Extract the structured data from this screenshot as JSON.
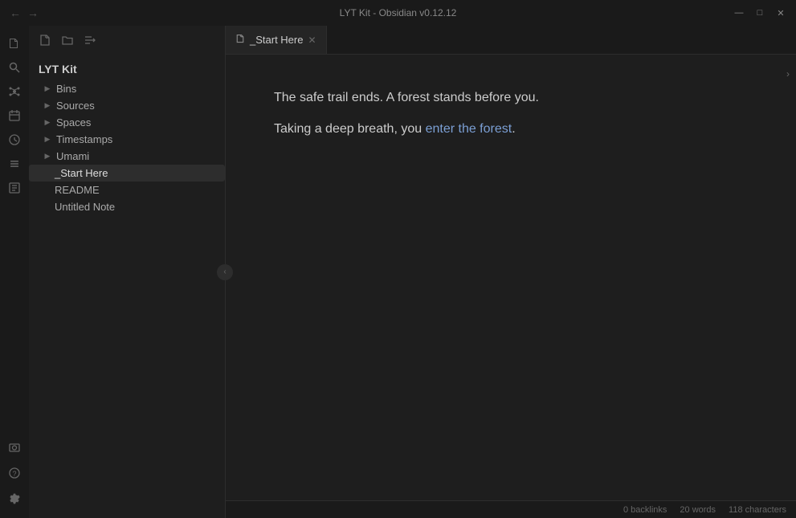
{
  "titleBar": {
    "title": "LYT Kit - Obsidian v0.12.12",
    "btnMinimize": "—",
    "btnMaximize": "□",
    "btnClose": "✕"
  },
  "ribbon": {
    "icons": [
      {
        "name": "files-icon",
        "glyph": "⊞",
        "active": false
      },
      {
        "name": "search-icon",
        "glyph": "⌕",
        "active": false
      },
      {
        "name": "graph-icon",
        "glyph": "⬡",
        "active": false
      },
      {
        "name": "calendar-icon",
        "glyph": "▦",
        "active": false
      },
      {
        "name": "clock-icon",
        "glyph": "◷",
        "active": false
      },
      {
        "name": "layers-icon",
        "glyph": "≡",
        "active": false
      },
      {
        "name": "tag-icon",
        "glyph": "⊡",
        "active": false
      }
    ],
    "bottomIcons": [
      {
        "name": "camera-icon",
        "glyph": "⊙"
      },
      {
        "name": "help-icon",
        "glyph": "?"
      },
      {
        "name": "settings-icon",
        "glyph": "⚙"
      }
    ]
  },
  "sidebar": {
    "toolbar": [
      {
        "name": "new-note-btn",
        "glyph": "📄"
      },
      {
        "name": "new-folder-btn",
        "glyph": "📁"
      },
      {
        "name": "sort-btn",
        "glyph": "⇅"
      }
    ],
    "vaultTitle": "LYT Kit",
    "treeItems": [
      {
        "type": "folder",
        "label": "Bins",
        "collapsed": true
      },
      {
        "type": "folder",
        "label": "Sources",
        "collapsed": true
      },
      {
        "type": "folder",
        "label": "Spaces",
        "collapsed": true
      },
      {
        "type": "folder",
        "label": "Timestamps",
        "collapsed": true
      },
      {
        "type": "folder",
        "label": "Umami",
        "collapsed": true
      },
      {
        "type": "file",
        "label": "_Start Here",
        "active": true
      },
      {
        "type": "file",
        "label": "README",
        "active": false
      },
      {
        "type": "file",
        "label": "Untitled Note",
        "active": false
      }
    ]
  },
  "tab": {
    "icon": "📄",
    "label": "_Start Here",
    "closeLabel": "✕"
  },
  "editor": {
    "line1": "The safe trail ends. A forest stands before you.",
    "line2_before": "Taking a deep breath, you ",
    "line2_link": "enter the forest",
    "line2_after": "."
  },
  "statusBar": {
    "backlinks": "0 backlinks",
    "words": "20 words",
    "characters": "118 characters"
  },
  "colors": {
    "link": "#7b9fd4",
    "background": "#1e1e1e",
    "sidebar_bg": "#1a1a1a"
  }
}
